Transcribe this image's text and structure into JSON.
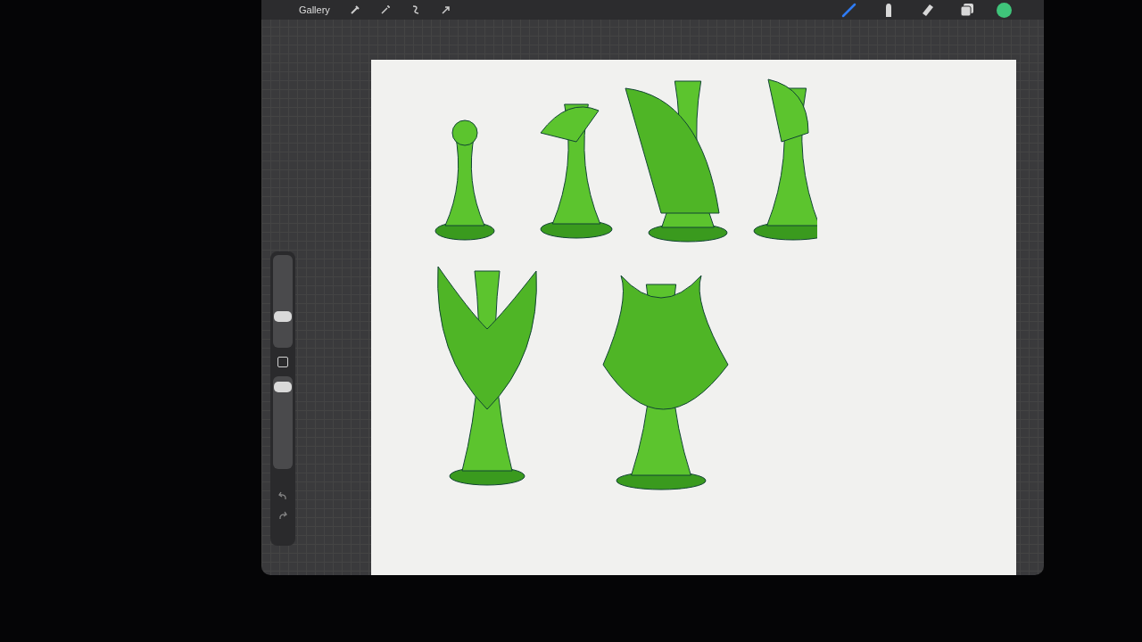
{
  "toolbar": {
    "gallery": "Gallery",
    "tools": [
      {
        "kind": "brush",
        "selected": true
      },
      {
        "kind": "smudge",
        "selected": false
      },
      {
        "kind": "eraser",
        "selected": false
      },
      {
        "kind": "layers",
        "selected": false
      }
    ]
  },
  "sidebar": {
    "brush_size": {
      "level": 0.31
    },
    "opacity": {
      "level": 0.94
    }
  }
}
